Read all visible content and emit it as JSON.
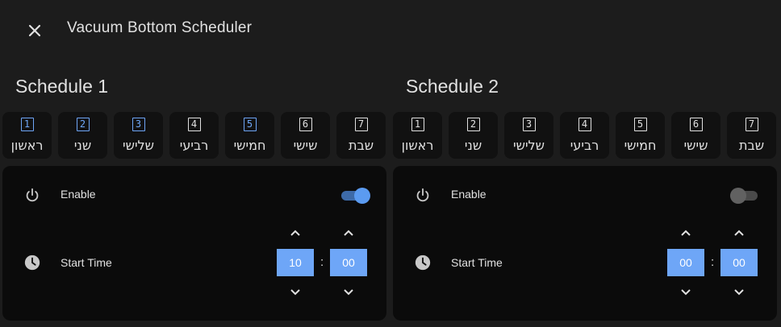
{
  "dialog": {
    "title": "Vacuum Bottom Scheduler"
  },
  "colors": {
    "accent": "#6ea6f7",
    "dialog_bg": "#1c1c1c",
    "card_bg": "#0b0b0b"
  },
  "schedules": [
    {
      "title": "Schedule 1",
      "days": [
        {
          "num": "1",
          "name": "ראשון",
          "active": true
        },
        {
          "num": "2",
          "name": "שני",
          "active": true
        },
        {
          "num": "3",
          "name": "שלישי",
          "active": true
        },
        {
          "num": "4",
          "name": "רביעי",
          "active": false
        },
        {
          "num": "5",
          "name": "חמישי",
          "active": true
        },
        {
          "num": "6",
          "name": "שישי",
          "active": false
        },
        {
          "num": "7",
          "name": "שבת",
          "active": false
        }
      ],
      "enable": {
        "label": "Enable",
        "value": true,
        "icon": "power-icon"
      },
      "start_time": {
        "label": "Start Time",
        "hours": "10",
        "separator": ":",
        "minutes": "00",
        "icon": "clock-icon"
      }
    },
    {
      "title": "Schedule 2",
      "days": [
        {
          "num": "1",
          "name": "ראשון",
          "active": false
        },
        {
          "num": "2",
          "name": "שני",
          "active": false
        },
        {
          "num": "3",
          "name": "שלישי",
          "active": false
        },
        {
          "num": "4",
          "name": "רביעי",
          "active": false
        },
        {
          "num": "5",
          "name": "חמישי",
          "active": false
        },
        {
          "num": "6",
          "name": "שישי",
          "active": false
        },
        {
          "num": "7",
          "name": "שבת",
          "active": false
        }
      ],
      "enable": {
        "label": "Enable",
        "value": false,
        "icon": "power-icon"
      },
      "start_time": {
        "label": "Start Time",
        "hours": "00",
        "separator": ":",
        "minutes": "00",
        "icon": "clock-icon"
      }
    }
  ]
}
